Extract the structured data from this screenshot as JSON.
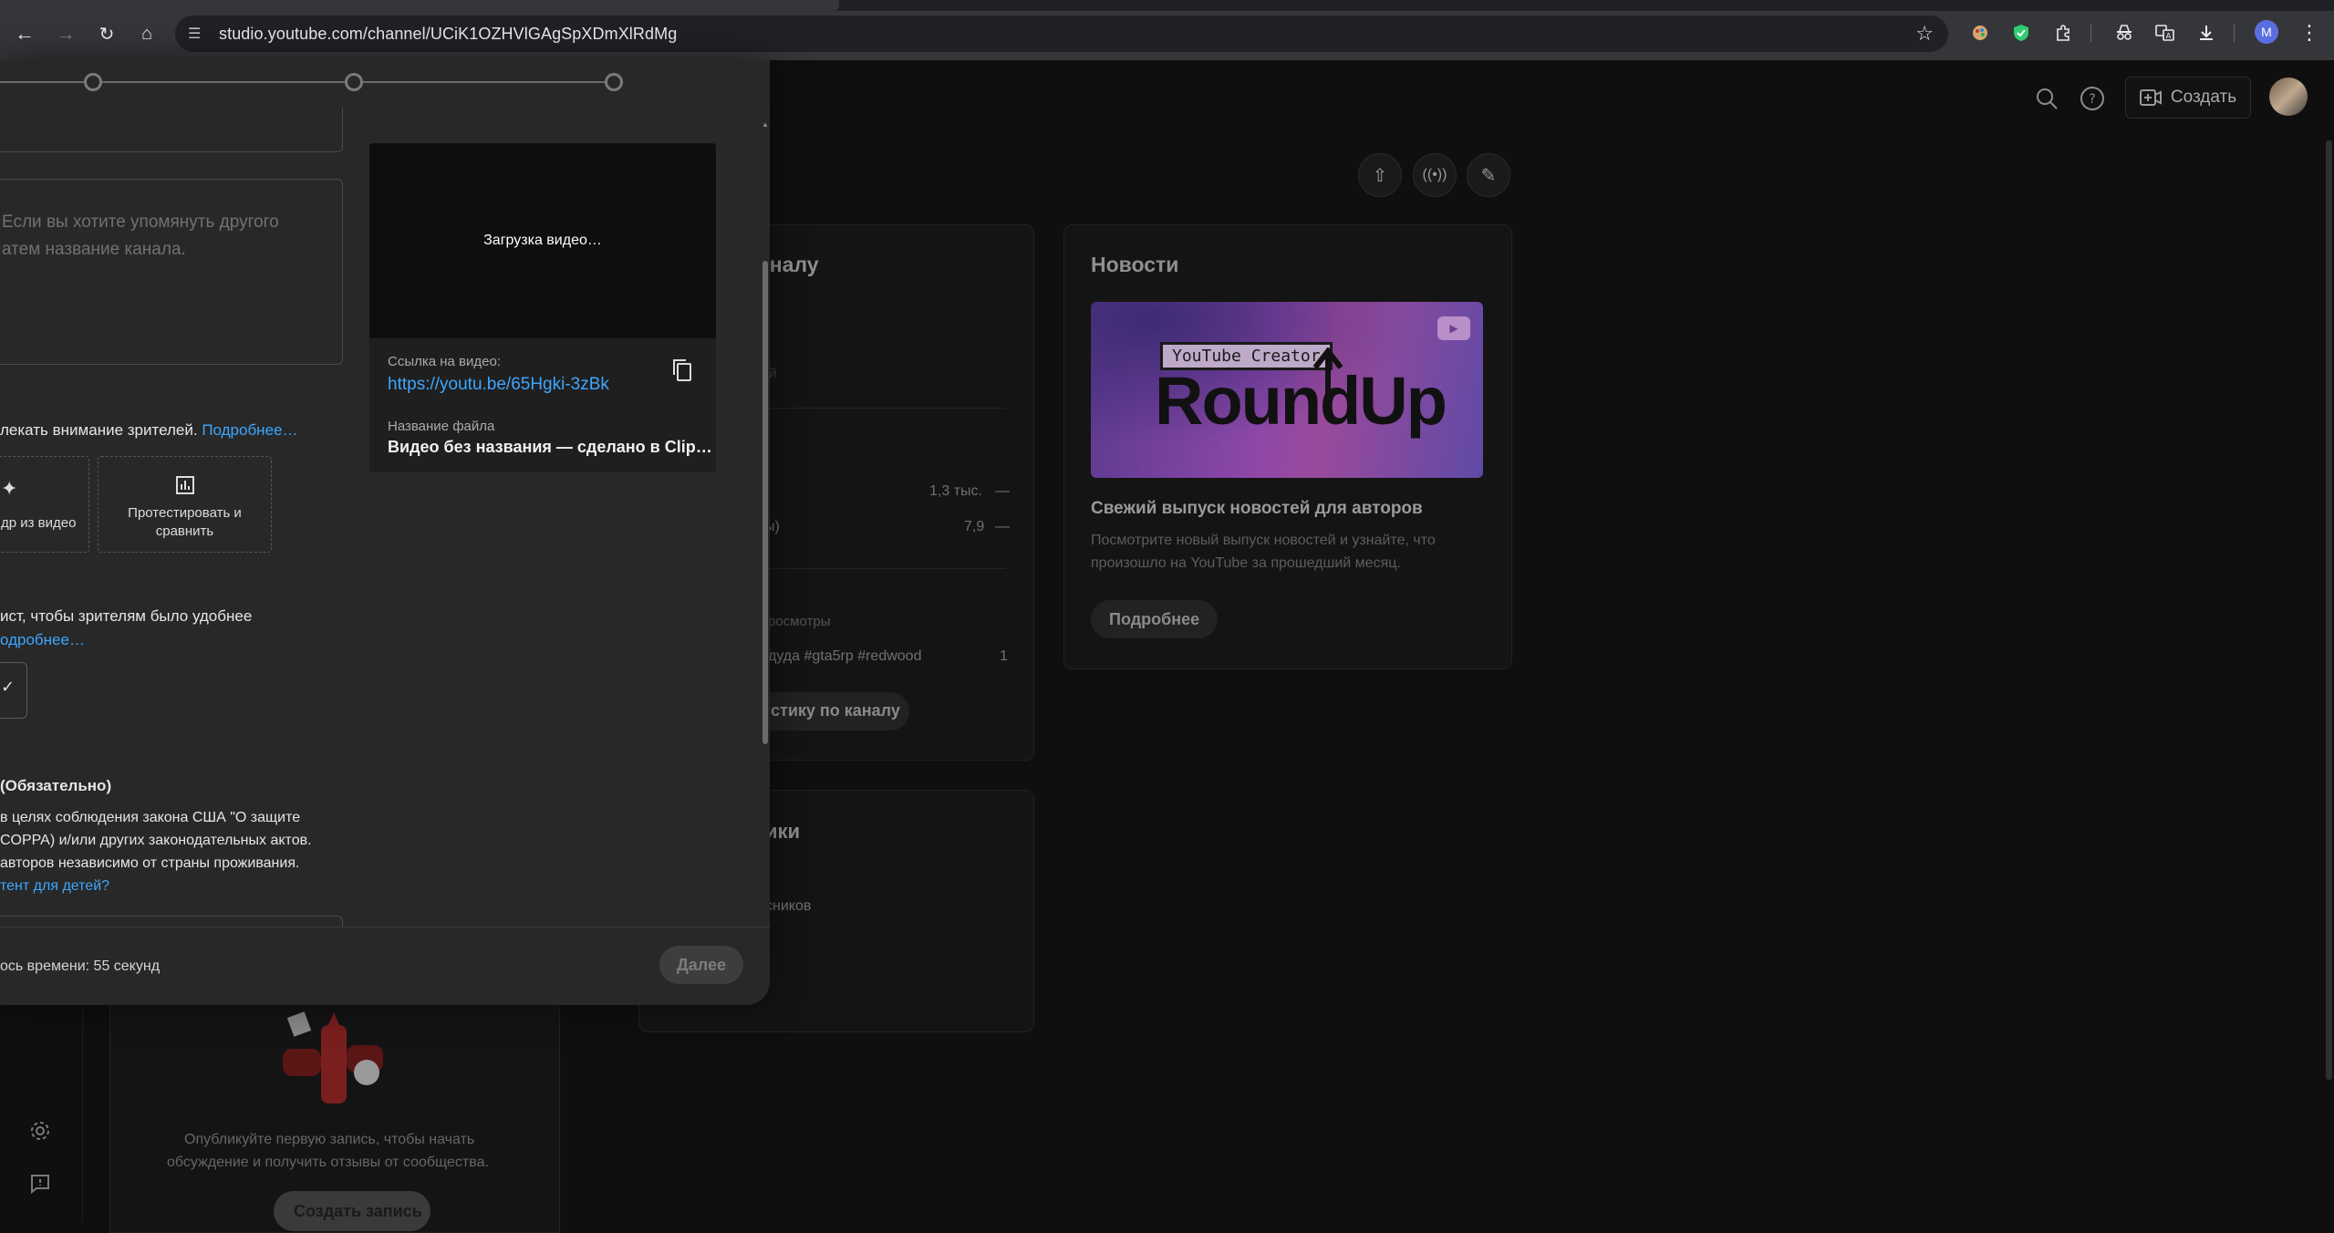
{
  "browser": {
    "url": "studio.youtube.com/channel/UCiK1OZHVlGAgSpXDmXlRdMg",
    "profile_initial": "M"
  },
  "header": {
    "create_label": "Создать"
  },
  "dialog": {
    "tags_placeholder_line1": "Если вы хотите упомянуть другого",
    "tags_placeholder_line2": "атем название канала.",
    "preview": {
      "loading_text": "Загрузка видео…",
      "link_label": "Ссылка на видео:",
      "link_value": "https://youtu.be/65Hgki-3zBk",
      "filename_label": "Название файла",
      "filename_value": "Видео без названия — сделано в Clip…"
    },
    "thumbnail_hint": "лекать внимание зрителей.",
    "thumbnail_hint_link": "Подробнее…",
    "thumb_option_1": "др из видео",
    "thumb_option_2_line1": "Протестировать и",
    "thumb_option_2_line2": "сравнить",
    "playlist_hint": "ист, чтобы зрителям было удобнее",
    "playlist_hint_link": "одробнее…",
    "playlist_select_glyph": "✓",
    "audience_title": "(Обязательно)",
    "audience_line1": "в целях соблюдения закона США \"О защите",
    "audience_line2": "COPPA) и/или других законодательных актов.",
    "audience_line3": "авторов независимо от страны проживания.",
    "audience_link": "тент для детей?",
    "footer_status": "ось времени: 55 секунд",
    "next_label": "Далее"
  },
  "analytics_card": {
    "title_fragment": "аналу",
    "faint_fragment": "ий",
    "row1_value": "1,3 тыс.",
    "row1_dash": "—",
    "row2_label": "ы)",
    "row2_value": "7,9",
    "row2_dash": "—",
    "views_label": "росмотры",
    "top_video": "дуда #gta5rp #redwood",
    "top_video_count": "1",
    "button_label": "стику по каналу"
  },
  "subscribers_card": {
    "title_fragment": "ики",
    "subtitle_fragment": "сников"
  },
  "news": {
    "title": "Новости",
    "banner_tag": "YouTube Creator",
    "banner_big": "RoundUp",
    "headline": "Свежий выпуск новостей для авторов",
    "description": "Посмотрите новый выпуск новостей и узнайте, что произошло на YouTube за прошедший месяц.",
    "button": "Подробнее"
  },
  "community": {
    "message_line1": "Опубликуйте первую запись, чтобы начать",
    "message_line2": "обсуждение и получить отзывы от сообщества.",
    "button": "Создать запись"
  },
  "colors": {
    "accent_link": "#3ea6ff",
    "dialog_bg": "#282828",
    "page_bg": "#0f0f0f"
  }
}
